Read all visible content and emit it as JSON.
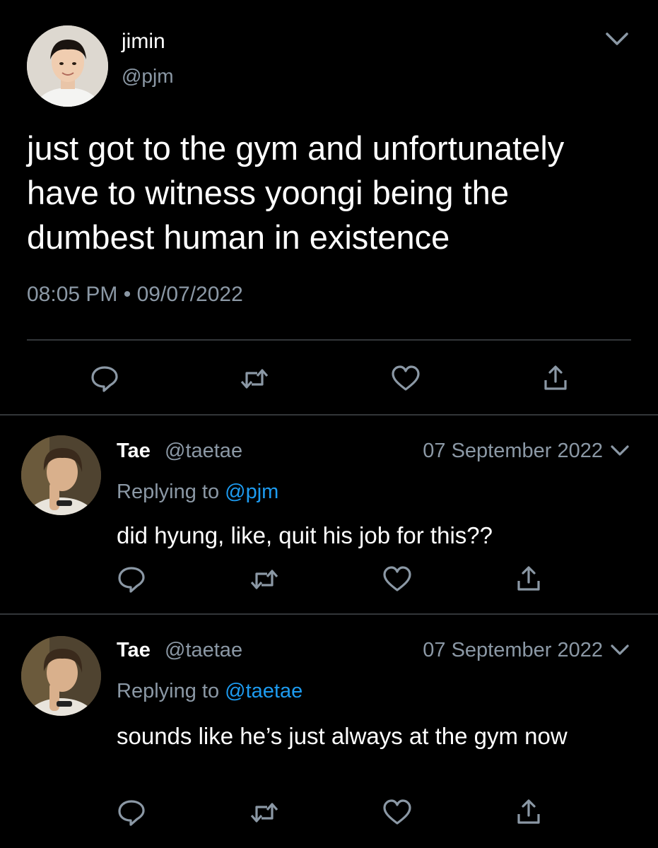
{
  "main": {
    "name": "jimin",
    "handle": "@pjm",
    "text": "just got to the gym and unfortunately have to witness yoongi being the dumbest human in existence",
    "time": "08:05 PM",
    "separator": "•",
    "date": "09/07/2022"
  },
  "replies": [
    {
      "name": "Tae",
      "handle": "@taetae",
      "date": "07 September 2022",
      "replying_prefix": "Replying to",
      "replying_to": "@pjm",
      "text": "did hyung, like, quit his job for this??"
    },
    {
      "name": "Tae",
      "handle": "@taetae",
      "date": "07 September 2022",
      "replying_prefix": "Replying to",
      "replying_to": "@taetae",
      "text": "sounds like he’s just always at the gym now"
    }
  ],
  "icons": {
    "reply": "comment-bubble-icon",
    "retweet": "retweet-icon",
    "like": "heart-icon",
    "share": "share-icon",
    "more": "chevron-down-icon"
  },
  "colors": {
    "background": "#000000",
    "text": "#ffffff",
    "secondary": "#8b98a5",
    "mention": "#1d9bf0",
    "divider": "#333639"
  }
}
